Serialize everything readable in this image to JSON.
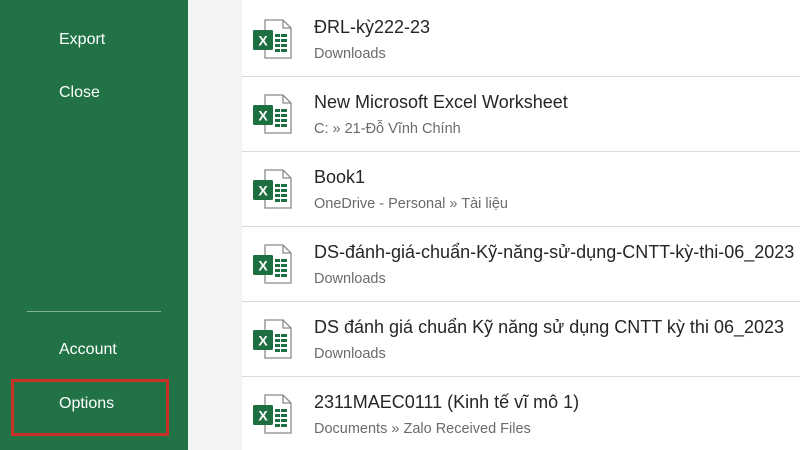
{
  "sidebar": {
    "items": [
      {
        "label": "Export"
      },
      {
        "label": "Close"
      },
      {
        "label": "Account"
      },
      {
        "label": "Options"
      }
    ]
  },
  "recent_files": [
    {
      "name": "ĐRL-kỳ222-23",
      "path": "Downloads",
      "icon": "excel-file-icon"
    },
    {
      "name": "New Microsoft Excel Worksheet",
      "path": "C: » 21-Đỗ Vĩnh Chính",
      "icon": "excel-file-icon"
    },
    {
      "name": "Book1",
      "path": "OneDrive - Personal » Tài liệu",
      "icon": "excel-file-icon"
    },
    {
      "name": "DS-đánh-giá-chuẩn-Kỹ-năng-sử-dụng-CNTT-kỳ-thi-06_2023",
      "path": "Downloads",
      "icon": "excel-file-icon"
    },
    {
      "name": "DS đánh giá chuẩn Kỹ năng sử dụng CNTT kỳ thi 06_2023",
      "path": "Downloads",
      "icon": "excel-file-icon"
    },
    {
      "name": "2311MAEC0111 (Kinh tế vĩ mô 1)",
      "path": "Documents » Zalo Received Files",
      "icon": "excel-file-icon"
    }
  ],
  "colors": {
    "sidebar_bg": "#217346",
    "highlight_border": "#c8312a",
    "excel_green": "#1d6f42"
  }
}
